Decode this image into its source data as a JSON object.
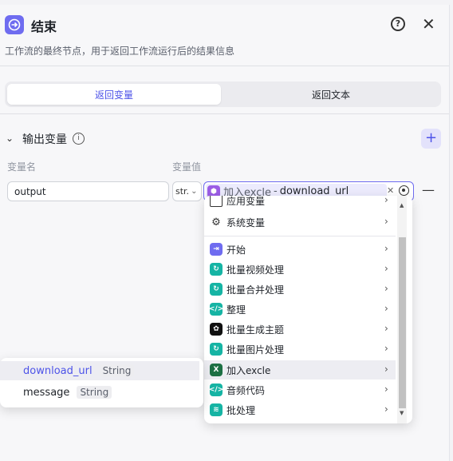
{
  "header": {
    "title": "结束",
    "description": "工作流的最终节点，用于返回工作流运行后的结果信息"
  },
  "tabs": [
    {
      "label": "返回变量",
      "active": true
    },
    {
      "label": "返回文本",
      "active": false
    }
  ],
  "output_section": {
    "title": "输出变量",
    "col_name_label": "变量名",
    "col_value_label": "变量值",
    "rows": [
      {
        "name": "output",
        "type": "str.",
        "ref_node": "加入excle",
        "ref_separator": "-",
        "ref_var": "download_url"
      }
    ]
  },
  "dropdown": {
    "items": [
      {
        "label": "应用变量",
        "icon": "app-variable-icon"
      },
      {
        "label": "系统变量",
        "icon": "gear-icon"
      },
      {
        "label": "开始",
        "icon": "start-node-icon",
        "color": "#6f6cf0"
      },
      {
        "label": "批量视频处理",
        "icon": "loop-icon",
        "color": "#16b4a4"
      },
      {
        "label": "批量合并处理",
        "icon": "loop-icon",
        "color": "#16b4a4"
      },
      {
        "label": "整理",
        "icon": "code-icon",
        "color": "#16b4a4"
      },
      {
        "label": "批量生成主题",
        "icon": "openai-icon",
        "color": "#111111"
      },
      {
        "label": "批量图片处理",
        "icon": "loop-icon",
        "color": "#16b4a4"
      },
      {
        "label": "加入excle",
        "icon": "excel-icon",
        "color": "#1d7044",
        "selected": true
      },
      {
        "label": "音频代码",
        "icon": "code-icon",
        "color": "#16b4a4"
      },
      {
        "label": "批处理",
        "icon": "batch-icon",
        "color": "#16b4a4"
      }
    ]
  },
  "subpanel": {
    "items": [
      {
        "name": "download_url",
        "type": "String",
        "highlight": true
      },
      {
        "name": "message",
        "type": "String",
        "highlight": false
      }
    ]
  }
}
